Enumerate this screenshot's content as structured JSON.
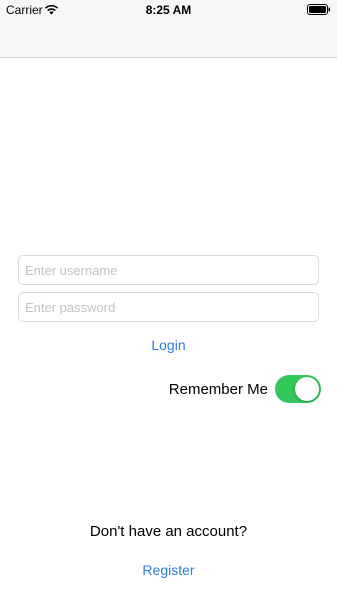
{
  "status_bar": {
    "carrier": "Carrier",
    "time": "8:25 AM",
    "wifi_icon": "wifi-icon",
    "battery_icon": "battery-icon"
  },
  "login_form": {
    "username": {
      "placeholder": "Enter username",
      "value": ""
    },
    "password": {
      "placeholder": "Enter password",
      "value": ""
    },
    "login_label": "Login",
    "remember_me_label": "Remember Me",
    "remember_me_on": true
  },
  "signup": {
    "prompt": "Don't have an account?",
    "register_label": "Register"
  },
  "colors": {
    "link": "#2f7bd9",
    "toggle_on": "#34c759",
    "bar_background": "#f7f7f7"
  }
}
